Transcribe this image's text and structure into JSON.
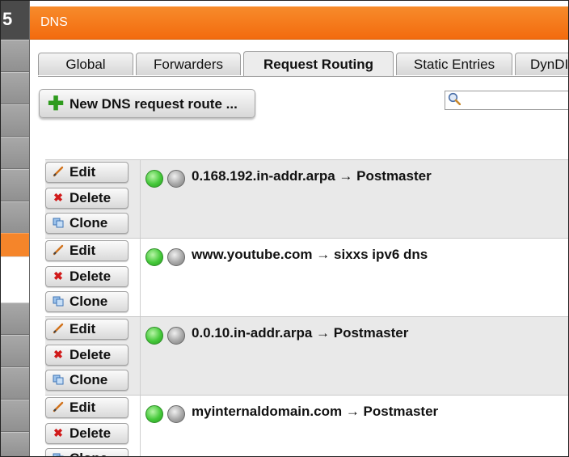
{
  "window": {
    "title": "DNS"
  },
  "rail": {
    "logo_glyph": "5"
  },
  "tabs": [
    {
      "label": "Global",
      "active": false
    },
    {
      "label": "Forwarders",
      "active": false
    },
    {
      "label": "Request Routing",
      "active": true
    },
    {
      "label": "Static Entries",
      "active": false
    },
    {
      "label": "DynDI",
      "active": false
    }
  ],
  "toolbar": {
    "new_button_label": "New DNS request route ...",
    "plus_glyph": "✚"
  },
  "search": {
    "value": "",
    "placeholder": ""
  },
  "actions": {
    "edit": "Edit",
    "delete": "Delete",
    "clone": "Clone"
  },
  "routes": [
    {
      "domain": "0.168.192.in-addr.arpa",
      "arrow": "→",
      "target": "Postmaster",
      "text": "0.168.192.in-addr.arpa → Postmaster",
      "enabled": true
    },
    {
      "domain": "www.youtube.com",
      "arrow": "→",
      "target": "sixxs ipv6 dns",
      "text": "www.youtube.com → sixxs ipv6 dns",
      "enabled": true
    },
    {
      "domain": "0.0.10.in-addr.arpa",
      "arrow": "→",
      "target": "Postmaster",
      "text": "0.0.10.in-addr.arpa → Postmaster",
      "enabled": true
    },
    {
      "domain": "myinternaldomain.com",
      "arrow": "→",
      "target": "Postmaster",
      "text": "myinternaldomain.com → Postmaster",
      "enabled": true
    }
  ],
  "colors": {
    "accent": "#f47a1f",
    "status_on": "#45c93a",
    "status_off": "#a8a8a8",
    "delete_icon": "#d11a1a",
    "add_icon": "#2e9b1d"
  }
}
